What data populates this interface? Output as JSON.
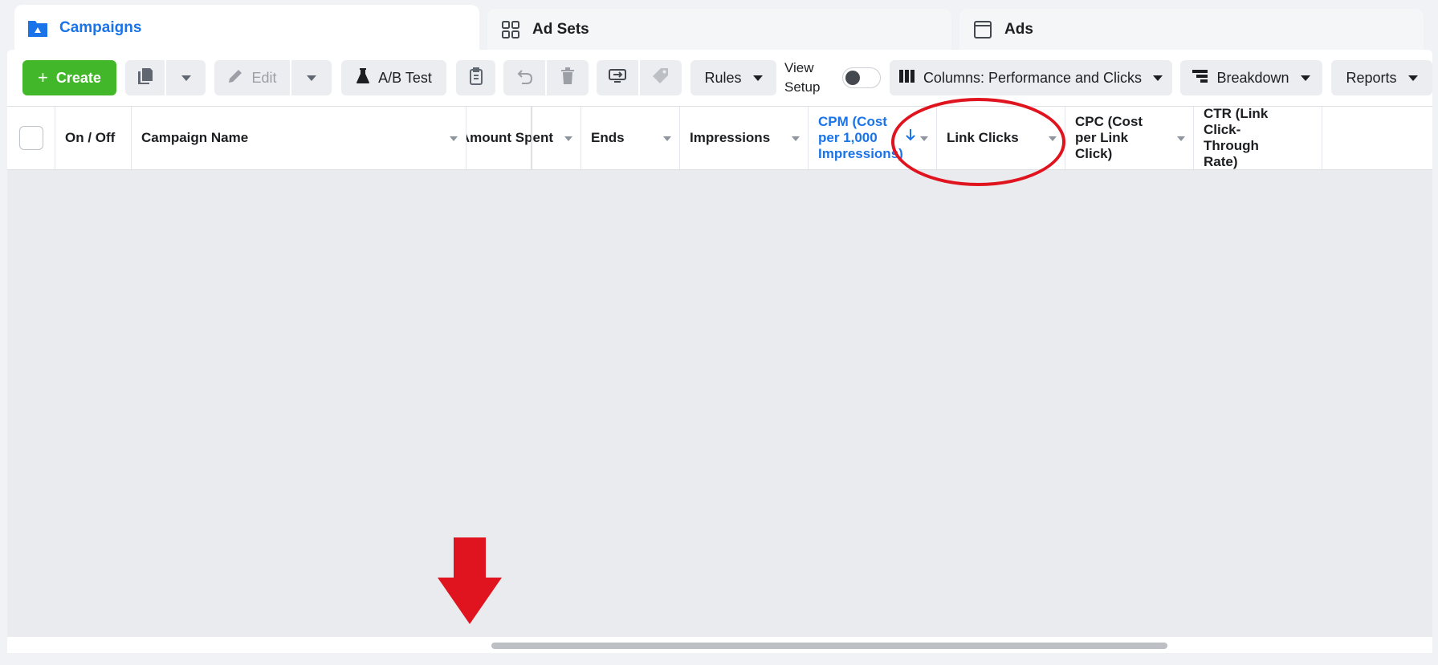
{
  "tabs": [
    {
      "label": "Campaigns",
      "icon": "campaign-folder-icon",
      "active": true
    },
    {
      "label": "Ad Sets",
      "icon": "grid-icon",
      "active": false
    },
    {
      "label": "Ads",
      "icon": "window-icon",
      "active": false
    }
  ],
  "toolbar": {
    "create_label": "Create",
    "edit_label": "Edit",
    "ab_test_label": "A/B Test",
    "rules_label": "Rules",
    "view_setup_line1": "View",
    "view_setup_line2": "Setup",
    "columns_label": "Columns: Performance and Clicks",
    "breakdown_label": "Breakdown",
    "reports_label": "Reports"
  },
  "table": {
    "columns": [
      "On / Off",
      "Campaign Name",
      "Amount Spent",
      "Ends",
      "Impressions",
      "CPM (Cost per 1,000 Impressions)",
      "Link Clicks",
      "CPC (Cost per Link Click)",
      "CTR (Link Click-Through Rate)"
    ],
    "sorted_column": "CPM (Cost per 1,000 Impressions)"
  },
  "colors": {
    "accent": "#1a73e8",
    "create_green": "#42b72a",
    "annotation_red": "#e0141e"
  }
}
